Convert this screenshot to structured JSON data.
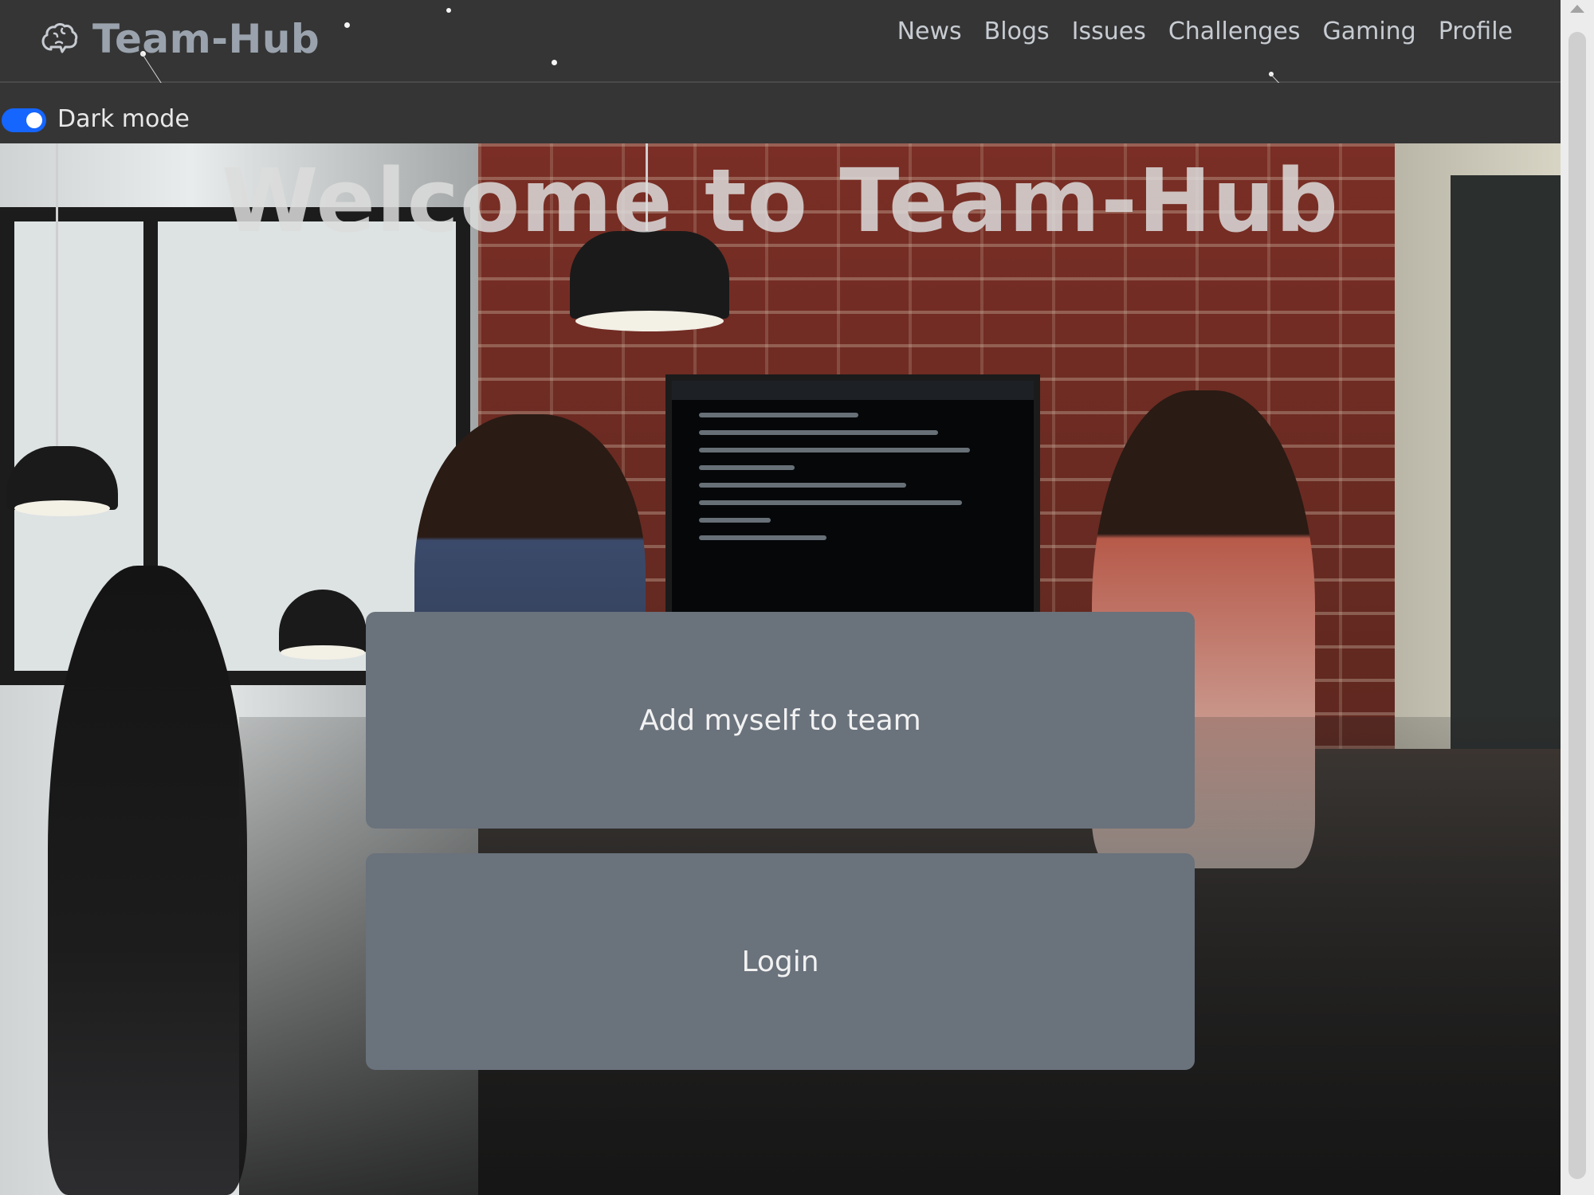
{
  "header": {
    "brand": "Team-Hub",
    "brand_icon": "brain-icon",
    "nav": [
      "News",
      "Blogs",
      "Issues",
      "Challenges",
      "Gaming",
      "Profile"
    ]
  },
  "toggle": {
    "label": "Dark mode",
    "state": "on",
    "accent": "#1565ff"
  },
  "hero": {
    "title": "Welcome to Team-Hub",
    "buttons": {
      "join": "Add myself to team",
      "login": "Login"
    }
  },
  "colors": {
    "navbar": "#353535",
    "button": "#6a727c",
    "brand_text": "#9aa3ad"
  }
}
